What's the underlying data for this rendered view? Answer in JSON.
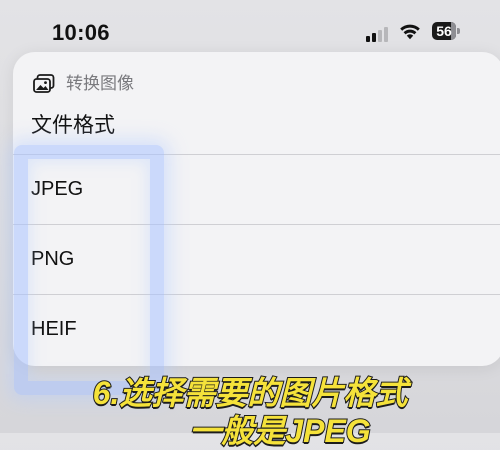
{
  "status_bar": {
    "time": "10:06",
    "battery_level": "56",
    "signal_icon": "cellular-signal-icon",
    "wifi_icon": "wifi-icon",
    "battery_icon": "battery-icon"
  },
  "menu": {
    "header_icon": "photos-icon",
    "header_title": "转换图像",
    "section_label": "文件格式",
    "items": [
      {
        "label": "JPEG"
      },
      {
        "label": "PNG"
      },
      {
        "label": "HEIF"
      }
    ]
  },
  "caption": {
    "line1": "6.选择需要的图片格式",
    "line2": "一般是JPEG",
    "color": "#f5e23a"
  },
  "highlight_color": "#aac3ff"
}
